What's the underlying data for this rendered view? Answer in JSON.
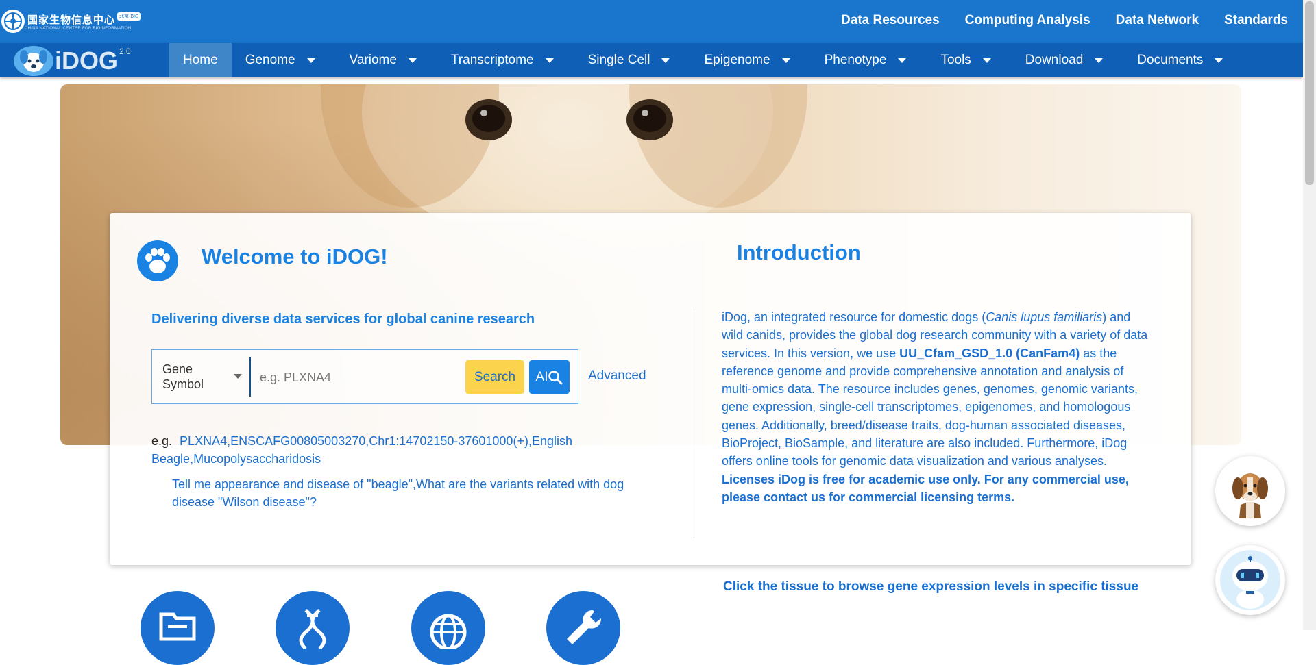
{
  "topbar": {
    "org_name": "国家生物信息中心",
    "org_sub": "CHINA NATIONAL CENTER FOR BIOINFORMATION",
    "org_badge": "北京·BIG",
    "links": [
      "Data Resources",
      "Computing Analysis",
      "Data Network",
      "Standards"
    ]
  },
  "nav": {
    "logo_text": "iDOG",
    "logo_version": "2.0",
    "items": [
      {
        "label": "Home",
        "dropdown": false,
        "active": true
      },
      {
        "label": "Genome",
        "dropdown": true
      },
      {
        "label": "Variome",
        "dropdown": true
      },
      {
        "label": "Transcriptome",
        "dropdown": true
      },
      {
        "label": "Single Cell",
        "dropdown": true
      },
      {
        "label": "Epigenome",
        "dropdown": true
      },
      {
        "label": "Phenotype",
        "dropdown": true
      },
      {
        "label": "Tools",
        "dropdown": true
      },
      {
        "label": "Download",
        "dropdown": true
      },
      {
        "label": "Documents",
        "dropdown": true
      }
    ]
  },
  "welcome": {
    "title": "Welcome to iDOG!",
    "tagline": "Delivering diverse data services for global canine research"
  },
  "search": {
    "type_selected": "Gene Symbol",
    "placeholder": "e.g. PLXNA4",
    "search_label": "Search",
    "ai_label": "AI",
    "advanced_label": "Advanced",
    "eg_prefix": "e.g.",
    "examples": [
      "PLXNA4",
      "ENSCAFG00805003270",
      "Chr1:14702150-37601000(+)",
      "English Beagle",
      "Mucopolysaccharidosis"
    ],
    "ai_examples": [
      "Tell me appearance and disease of \"beagle\"",
      "What are the variants related with dog disease \"Wilson disease\"?"
    ]
  },
  "intro": {
    "title": "Introduction",
    "p1": "iDog, an integrated resource for domestic dogs (",
    "species": "Canis lupus familiaris",
    "p2": ") and wild canids, provides the global dog research community with a variety of data services. In this version, we use ",
    "genome_ref": "UU_Cfam_GSD_1.0 (CanFam4)",
    "p3": " as the reference genome and provide comprehensive annotation and analysis of multi-omics data. The resource includes genes, genomes, genomic variants, gene expression, single-cell transcriptomes, epigenomes, and homologous genes. Additionally, breed/disease traits, dog-human associated diseases, BioProject, BioSample, and literature are also included. Furthermore, iDog offers online tools for genomic data visualization and various analyses. ",
    "license": "Licenses iDog is free for academic use only. For any commercial use, please contact us for commercial licensing terms."
  },
  "tissue": {
    "text": "Click the tissue to browse gene expression levels in specific tissue"
  },
  "icons": {
    "feature_1": "folder-icon",
    "feature_2": "dna-icon",
    "feature_3": "globe-icon",
    "feature_4": "wrench-icon"
  },
  "colors": {
    "topbar": "#1976cc",
    "navbar": "#0e5fb5",
    "accent": "#1a82e2",
    "search_button": "#fcd34d"
  }
}
